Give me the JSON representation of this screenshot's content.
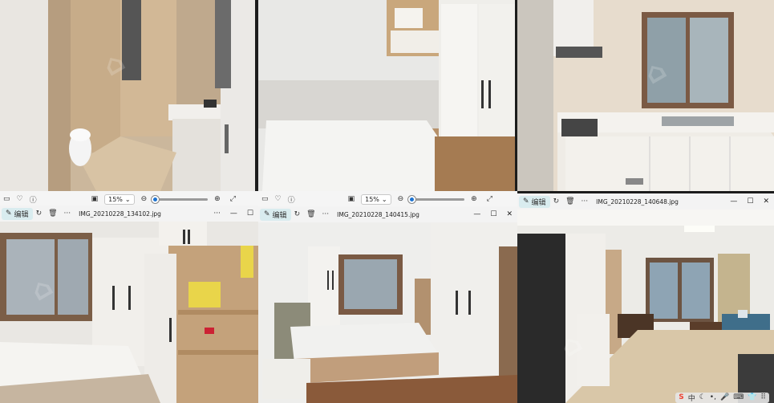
{
  "viewer_top": {
    "zoom_left": "15%",
    "zoom_right": "15%"
  },
  "windows": [
    {
      "edit_label": "编辑",
      "filename": "IMG_20210228_134102.jpg"
    },
    {
      "edit_label": "编辑",
      "filename": "IMG_20210228_140415.jpg"
    },
    {
      "edit_label": "编辑",
      "filename": "IMG_20210228_140648.jpg"
    }
  ],
  "taskbar": {
    "ime_label": "中",
    "tray_glyphs": [
      "S",
      "中",
      "♪",
      "•",
      "🎤",
      "⌨",
      "👕",
      "⋮⋮"
    ]
  },
  "colors": {
    "toolbar_bg": "#f3f3f3",
    "accent": "#1e73d0",
    "edit_bg": "#d9ecef"
  }
}
